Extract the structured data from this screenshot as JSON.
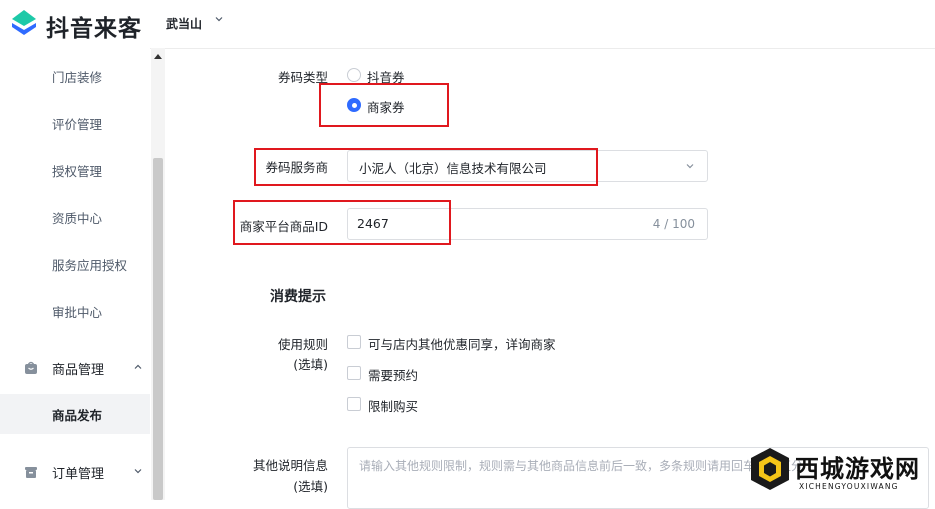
{
  "header": {
    "app_name": "抖音来客",
    "store_name": "武当山"
  },
  "sidebar": {
    "items": [
      "门店装修",
      "评价管理",
      "授权管理",
      "资质中心",
      "服务应用授权",
      "审批中心"
    ],
    "groups": {
      "goods": {
        "label": "商品管理",
        "active_child": "商品发布"
      },
      "orders": {
        "label": "订单管理"
      }
    }
  },
  "form": {
    "coupon_type": {
      "label": "券码类型",
      "options": [
        "抖音券",
        "商家券"
      ],
      "selected": "商家券"
    },
    "provider": {
      "label": "券码服务商",
      "value": "小泥人（北京）信息技术有限公司"
    },
    "product_id": {
      "label": "商家平台商品ID",
      "value": "2467",
      "counter": "4 / 100"
    },
    "section_title": "消费提示",
    "usage_rules": {
      "label_line1": "使用规则",
      "label_line2": "(选填)",
      "options": [
        "可与店内其他优惠同享，详询商家",
        "需要预约",
        "限制购买"
      ]
    },
    "other_info": {
      "label_line1": "其他说明信息",
      "label_line2": "(选填)",
      "placeholder": "请输入其他规则限制，规则需与其他商品信息前后一致，多条规则请用回车进行区分"
    }
  },
  "watermark": {
    "title": "西城游戏网",
    "subtitle": "XICHENGYOUXIWANG"
  },
  "colors": {
    "accent": "#2f6bff",
    "highlight": "#e0181e",
    "logo": "#1dc9a8"
  }
}
